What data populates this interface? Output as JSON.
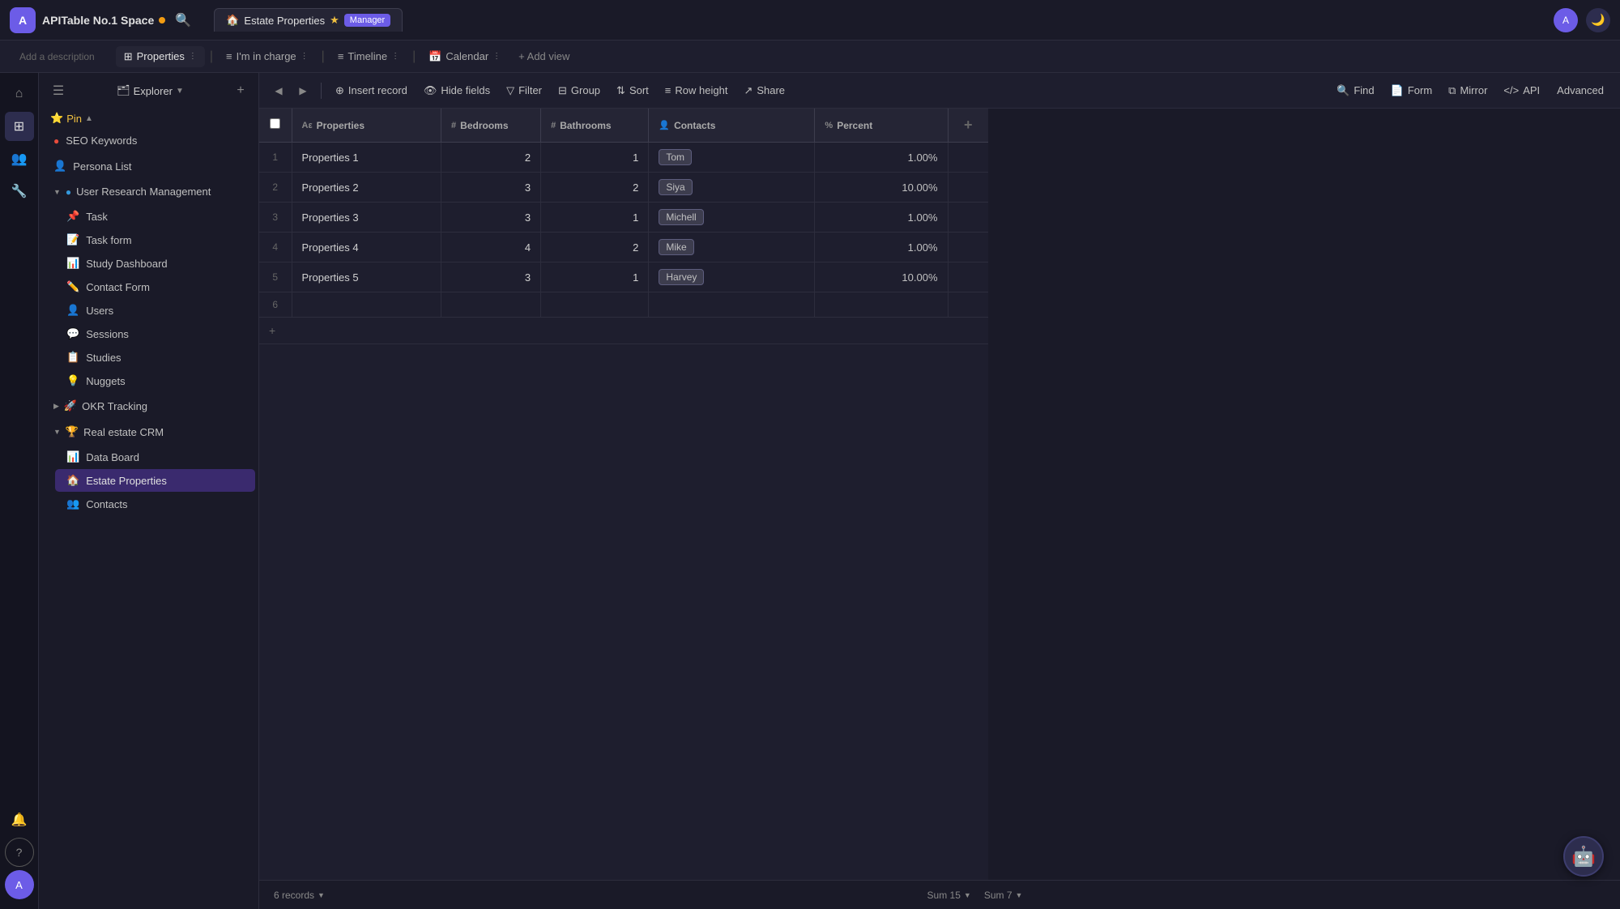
{
  "app": {
    "logo": "A",
    "space_title": "APITable No.1 Space",
    "search_icon": "🔍"
  },
  "tabs": [
    {
      "id": "properties",
      "label": "Properties",
      "icon": "⊞",
      "active": true
    },
    {
      "id": "im_in_charge",
      "label": "I'm in charge",
      "icon": "≡",
      "active": false
    },
    {
      "id": "timeline",
      "label": "Timeline",
      "icon": "≡",
      "active": false
    },
    {
      "id": "calendar",
      "label": "Calendar",
      "icon": "📅",
      "active": false
    }
  ],
  "add_view_label": "+ Add view",
  "current_table": {
    "name": "Estate Properties",
    "icon": "🏠",
    "starred": true,
    "badge": "Manager",
    "description": "Add a description"
  },
  "toolbar": {
    "insert_record": "Insert record",
    "hide_fields": "Hide fields",
    "filter": "Filter",
    "group": "Group",
    "sort": "Sort",
    "row_height": "Row height",
    "share": "Share",
    "find": "Find",
    "form": "Form",
    "mirror": "Mirror",
    "api": "API",
    "advanced": "Advanced"
  },
  "columns": [
    {
      "id": "properties",
      "label": "Properties",
      "icon": "Aε"
    },
    {
      "id": "bedrooms",
      "label": "Bedrooms",
      "icon": "#"
    },
    {
      "id": "bathrooms",
      "label": "Bathrooms",
      "icon": "#"
    },
    {
      "id": "contacts",
      "label": "Contacts",
      "icon": "👤"
    },
    {
      "id": "percent",
      "label": "Percent",
      "icon": "%"
    }
  ],
  "rows": [
    {
      "num": 1,
      "properties": "Properties 1",
      "bedrooms": 2,
      "bathrooms": 1,
      "contacts": "Tom",
      "percent": "1.00%"
    },
    {
      "num": 2,
      "properties": "Properties 2",
      "bedrooms": 3,
      "bathrooms": 2,
      "contacts": "Siya",
      "percent": "10.00%"
    },
    {
      "num": 3,
      "properties": "Properties 3",
      "bedrooms": 3,
      "bathrooms": 1,
      "contacts": "Michell",
      "percent": "1.00%"
    },
    {
      "num": 4,
      "properties": "Properties 4",
      "bedrooms": 4,
      "bathrooms": 2,
      "contacts": "Mike",
      "percent": "1.00%"
    },
    {
      "num": 5,
      "properties": "Properties 5",
      "bedrooms": 3,
      "bathrooms": 1,
      "contacts": "Harvey",
      "percent": "10.00%"
    },
    {
      "num": 6,
      "properties": "",
      "bedrooms": "",
      "bathrooms": "",
      "contacts": "",
      "percent": ""
    }
  ],
  "status_bar": {
    "records": "6 records",
    "sum_bedrooms": "Sum 15",
    "sum_bathrooms": "Sum 7"
  },
  "sidebar": {
    "explorer_label": "Explorer",
    "add_label": "+",
    "items_pinned": [],
    "pin_label": "Pin",
    "groups": [
      {
        "id": "seo",
        "label": "SEO Keywords",
        "icon": "🔴",
        "expanded": false,
        "children": []
      },
      {
        "id": "persona",
        "label": "Persona List",
        "icon": "👤",
        "expanded": false,
        "children": []
      },
      {
        "id": "user_research",
        "label": "User Research Management",
        "icon": "🔵",
        "expanded": true,
        "children": [
          {
            "id": "task",
            "label": "Task",
            "icon": "📌"
          },
          {
            "id": "task_form",
            "label": "Task form",
            "icon": "📝"
          },
          {
            "id": "study_dashboard",
            "label": "Study Dashboard",
            "icon": "📊"
          },
          {
            "id": "contact_form",
            "label": "Contact Form",
            "icon": "✏️"
          },
          {
            "id": "users",
            "label": "Users",
            "icon": "👤"
          },
          {
            "id": "sessions",
            "label": "Sessions",
            "icon": "💬"
          },
          {
            "id": "studies",
            "label": "Studies",
            "icon": "📋"
          },
          {
            "id": "nuggets",
            "label": "Nuggets",
            "icon": "💡"
          }
        ]
      },
      {
        "id": "okr",
        "label": "OKR Tracking",
        "icon": "🚀",
        "expanded": false,
        "children": []
      },
      {
        "id": "real_estate",
        "label": "Real estate CRM",
        "icon": "🏆",
        "expanded": true,
        "children": [
          {
            "id": "data_board",
            "label": "Data Board",
            "icon": "📊"
          },
          {
            "id": "estate_properties",
            "label": "Estate Properties",
            "icon": "🏠",
            "active": true
          },
          {
            "id": "contacts_item",
            "label": "Contacts",
            "icon": "👥"
          }
        ]
      }
    ]
  },
  "left_nav": [
    {
      "id": "home",
      "icon": "⌂",
      "active": false
    },
    {
      "id": "table",
      "icon": "⊞",
      "active": true
    },
    {
      "id": "people",
      "icon": "👥",
      "active": false
    },
    {
      "id": "tools",
      "icon": "🔧",
      "active": false
    }
  ],
  "footer_left_nav": [
    {
      "id": "notifications",
      "icon": "🔔"
    },
    {
      "id": "help",
      "icon": "?"
    }
  ]
}
